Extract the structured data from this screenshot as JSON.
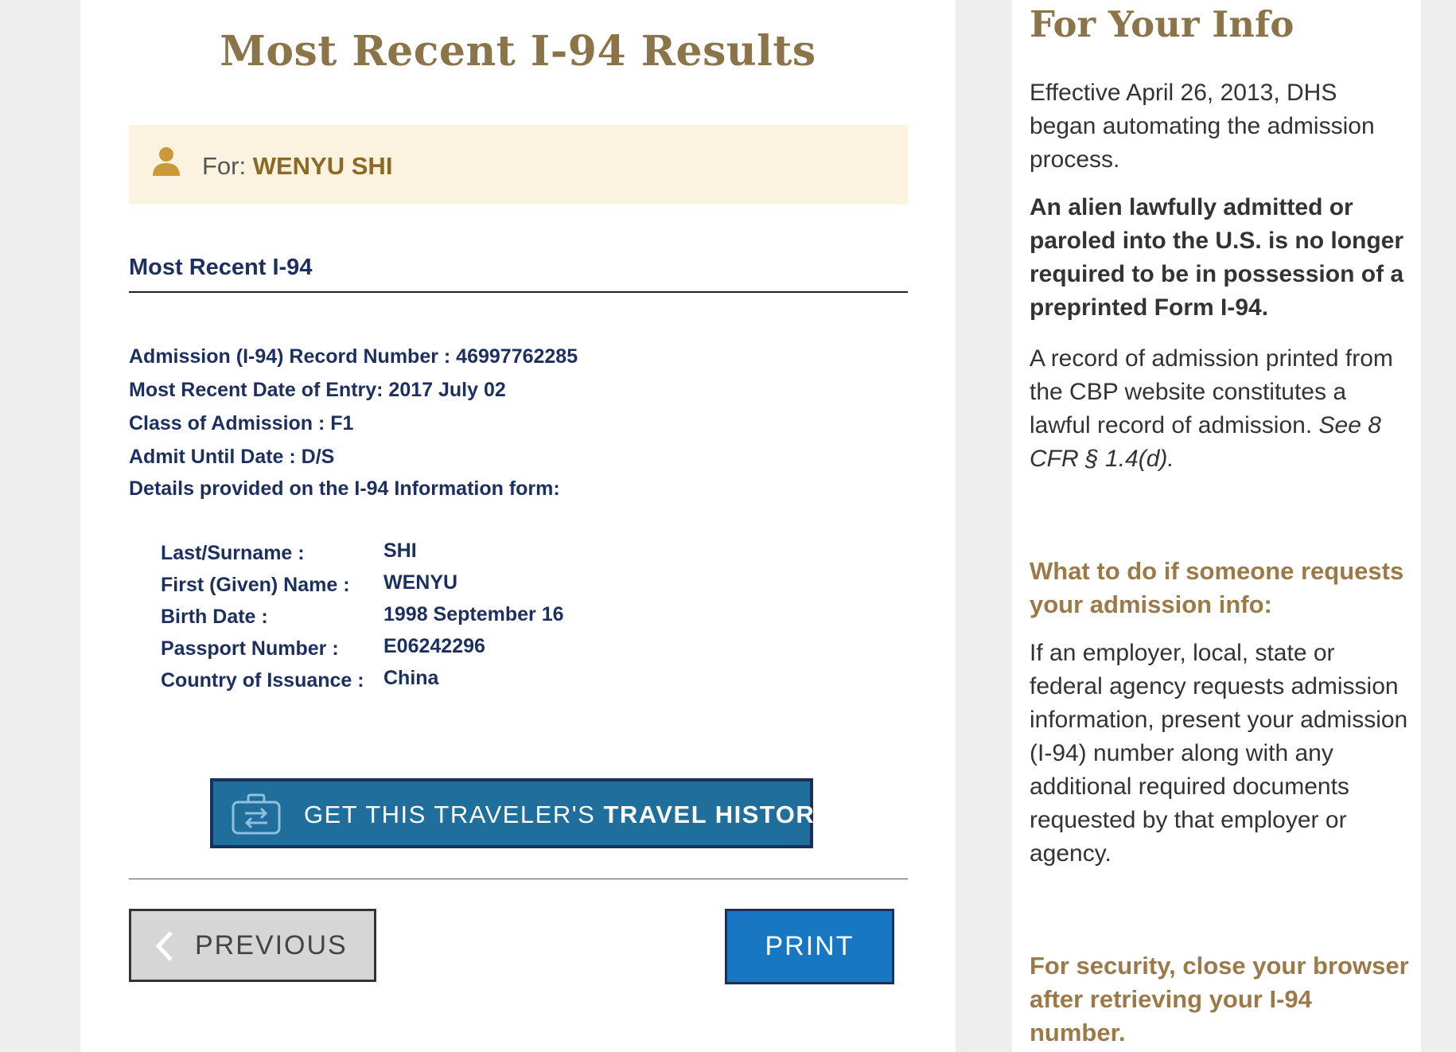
{
  "main": {
    "title": "Most Recent I-94 Results",
    "for_label": "For:",
    "for_name": "WENYU SHI",
    "section_heading": "Most Recent I-94",
    "record_lines": [
      "Admission (I-94) Record Number : 46997762285",
      "Most Recent Date of Entry: 2017 July 02",
      "Class of Admission : F1",
      "Admit Until Date : D/S",
      "Details provided on the I-94 Information form:"
    ],
    "details": [
      {
        "label": "Last/Surname :",
        "value": "SHI"
      },
      {
        "label": "First (Given) Name :",
        "value": "WENYU"
      },
      {
        "label": "Birth Date :",
        "value": "1998 September 16"
      },
      {
        "label": "Passport Number :",
        "value": "E06242296"
      },
      {
        "label": "Country of Issuance :",
        "value": "China"
      }
    ],
    "travel_button": {
      "prefix": "GET THIS TRAVELER'S ",
      "bold": "TRAVEL HISTORY"
    },
    "previous_label": "PREVIOUS",
    "print_label": "PRINT"
  },
  "sidebar": {
    "title": "For Your Info",
    "p1": "Effective April 26, 2013, DHS began automating the admission process.",
    "p2": "An alien lawfully admitted or paroled into the U.S. is no longer required to be in possession of a preprinted Form I-94.",
    "p3_text": "A record of admission printed from the CBP website constitutes a lawful record of admission.",
    "p3_cite": "See 8 CFR § 1.4(d).",
    "h1": "What to do if someone requests your admission info:",
    "p4": "If an employer, local, state or federal agency requests admission information, present your admission (I-94) number along with any additional required documents requested by that employer or agency.",
    "h2": "For security, close your browser after retrieving your I-94 number."
  },
  "colors": {
    "title_gold": "#8b7448",
    "name_gold": "#8b6a24",
    "navy": "#1c2f5e",
    "for_box_bg": "#fcf2e0",
    "travel_button_bg": "#1f6e9b",
    "print_button_bg": "#1877c3"
  }
}
